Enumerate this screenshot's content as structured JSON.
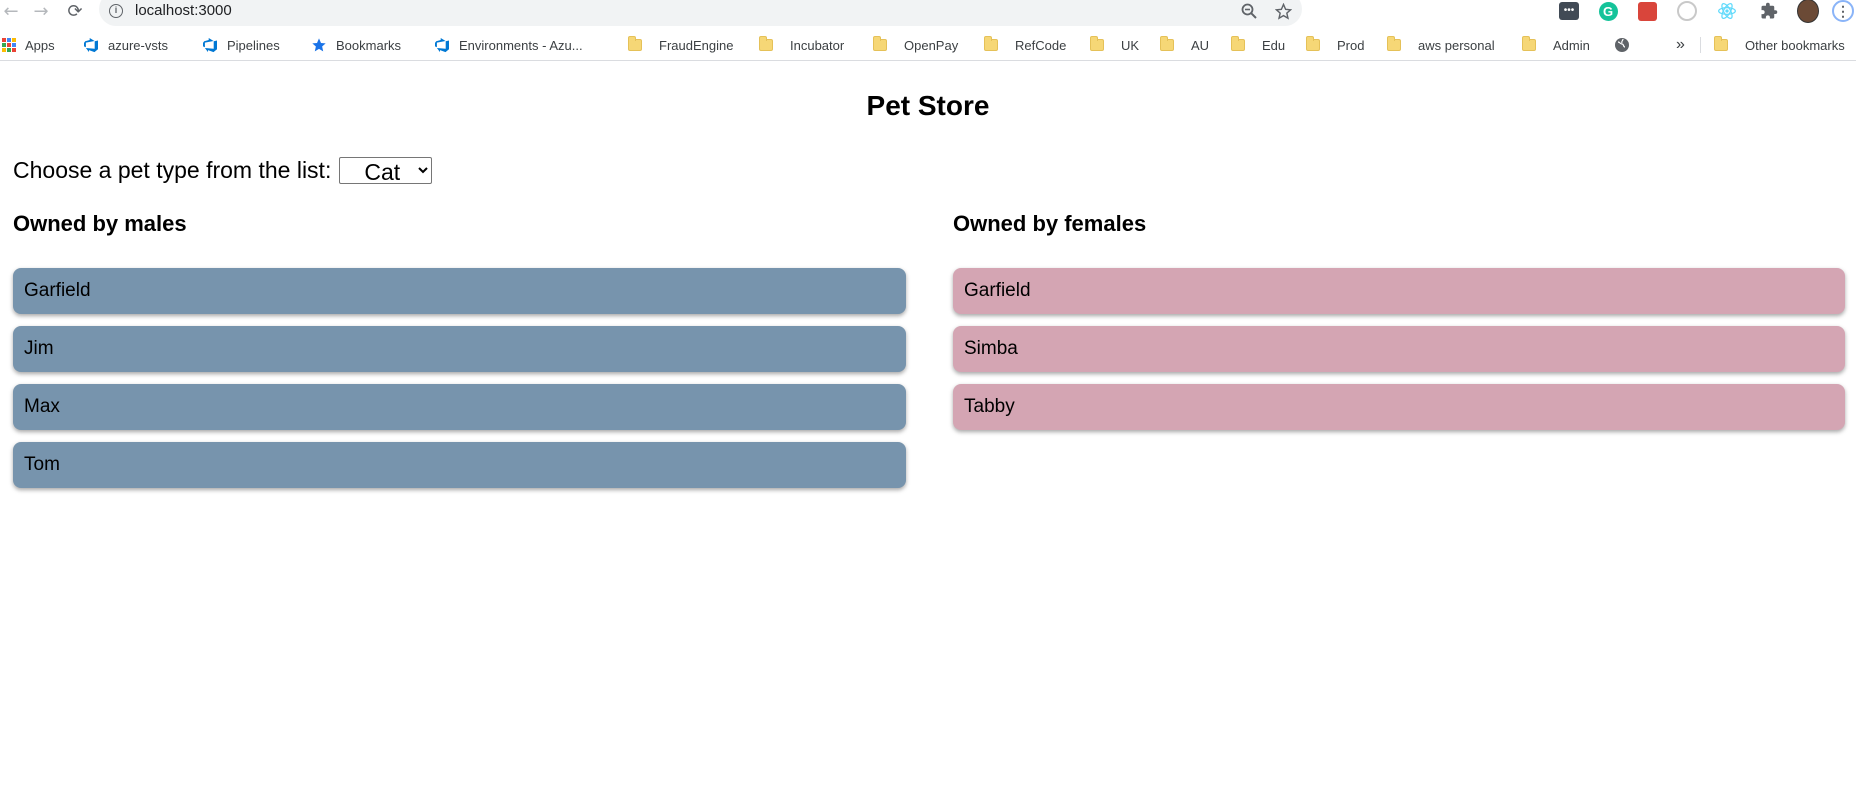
{
  "browser": {
    "url": "localhost:3000",
    "bookmarks": [
      {
        "label": "Apps",
        "icon": "apps-grid-icon"
      },
      {
        "label": "azure-vsts",
        "icon": "azure-devops-icon"
      },
      {
        "label": "Pipelines",
        "icon": "azure-devops-icon"
      },
      {
        "label": "Bookmarks",
        "icon": "star-icon"
      },
      {
        "label": "Environments - Azu...",
        "icon": "azure-devops-icon"
      },
      {
        "label": "FraudEngine",
        "icon": "folder-icon"
      },
      {
        "label": "Incubator",
        "icon": "folder-icon"
      },
      {
        "label": "OpenPay",
        "icon": "folder-icon"
      },
      {
        "label": "RefCode",
        "icon": "folder-icon"
      },
      {
        "label": "UK",
        "icon": "folder-icon"
      },
      {
        "label": "AU",
        "icon": "folder-icon"
      },
      {
        "label": "Edu",
        "icon": "folder-icon"
      },
      {
        "label": "Prod",
        "icon": "folder-icon"
      },
      {
        "label": "aws personal",
        "icon": "folder-icon"
      },
      {
        "label": "Admin",
        "icon": "folder-icon"
      }
    ],
    "overflow_label": "»",
    "other_bookmarks": "Other bookmarks"
  },
  "page": {
    "title": "Pet Store",
    "chooser_label": "Choose a pet type from the list:",
    "selected_pet_type": "Cat",
    "males": {
      "heading": "Owned by males",
      "color": "#7794ad",
      "pets": [
        "Garfield",
        "Jim",
        "Max",
        "Tom"
      ]
    },
    "females": {
      "heading": "Owned by females",
      "color": "#d4a5b3",
      "pets": [
        "Garfield",
        "Simba",
        "Tabby"
      ]
    }
  }
}
